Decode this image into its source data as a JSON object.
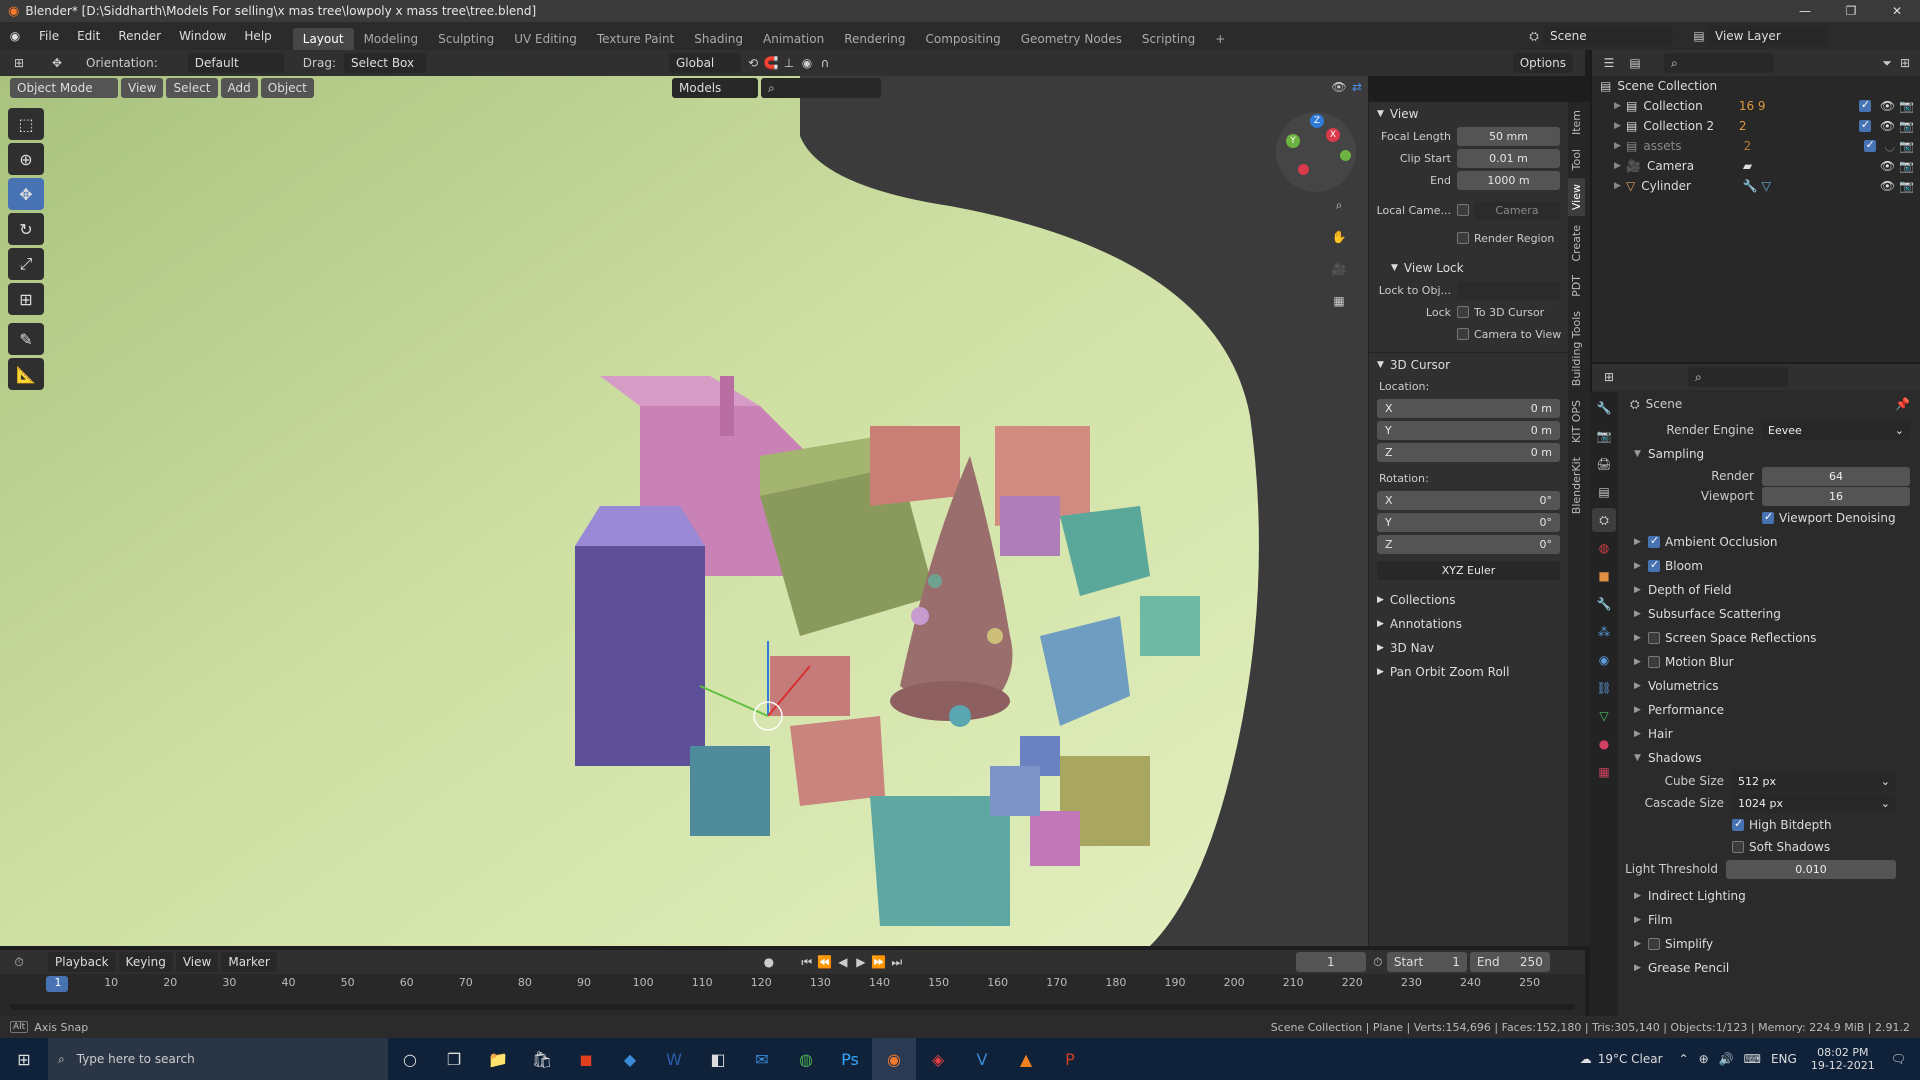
{
  "window": {
    "title": "Blender* [D:\\Siddharth\\Models For selling\\x mas tree\\lowpoly x mass tree\\tree.blend]",
    "controls": [
      "—",
      "❐",
      "✕"
    ]
  },
  "menu": [
    "File",
    "Edit",
    "Render",
    "Window",
    "Help"
  ],
  "workspaces": [
    "Layout",
    "Modeling",
    "Sculpting",
    "UV Editing",
    "Texture Paint",
    "Shading",
    "Animation",
    "Rendering",
    "Compositing",
    "Geometry Nodes",
    "Scripting"
  ],
  "active_workspace": "Layout",
  "scene_selector": "Scene",
  "view_layer": "View Layer",
  "header": {
    "orientation_label": "Orientation:",
    "orientation_value": "Default",
    "drag_label": "Drag:",
    "drag_value": "Select Box",
    "transform": "Global",
    "options": "Options"
  },
  "viewport_header": {
    "mode": "Object Mode",
    "menus": [
      "View",
      "Select",
      "Add",
      "Object"
    ],
    "models": "Models"
  },
  "npanel": {
    "view_title": "View",
    "focal_length_label": "Focal Length",
    "focal_length": "50 mm",
    "clip_start_label": "Clip Start",
    "clip_start": "0.01 m",
    "end_label": "End",
    "end": "1000 m",
    "local_camera_label": "Local Came...",
    "local_camera_value": "Camera",
    "render_region": "Render Region",
    "view_lock_title": "View Lock",
    "lock_to_obj_label": "Lock to Obj...",
    "lock_label": "Lock",
    "to_3d_cursor": "To 3D Cursor",
    "camera_to_view": "Camera to View",
    "cursor_title": "3D Cursor",
    "location_label": "Location:",
    "rotation_label": "Rotation:",
    "location": [
      {
        "axis": "X",
        "value": "0 m"
      },
      {
        "axis": "Y",
        "value": "0 m"
      },
      {
        "axis": "Z",
        "value": "0 m"
      }
    ],
    "rotation": [
      {
        "axis": "X",
        "value": "0°"
      },
      {
        "axis": "Y",
        "value": "0°"
      },
      {
        "axis": "Z",
        "value": "0°"
      }
    ],
    "rotation_mode": "XYZ Euler",
    "collapsed": [
      "Collections",
      "Annotations",
      "3D Nav",
      "Pan Orbit Zoom Roll"
    ]
  },
  "side_tabs": [
    "Item",
    "Tool",
    "View",
    "Create",
    "PDT",
    "Building Tools",
    "KIT OPS",
    "BlenderKit"
  ],
  "active_side_tab": "View",
  "outliner": {
    "root": "Scene Collection",
    "items": [
      {
        "name": "Collection",
        "dim": false,
        "badges": "16 9"
      },
      {
        "name": "Collection 2",
        "dim": false,
        "badges": "2"
      },
      {
        "name": "assets",
        "dim": true,
        "badges": "2"
      },
      {
        "name": "Camera",
        "dim": false,
        "badges": ""
      },
      {
        "name": "Cylinder",
        "dim": false,
        "badges": ""
      }
    ]
  },
  "properties": {
    "context": "Scene",
    "render_engine_label": "Render Engine",
    "render_engine": "Eevee",
    "sampling": "Sampling",
    "render_label": "Render",
    "render_samples": "64",
    "viewport_label": "Viewport",
    "viewport_samples": "16",
    "viewport_denoising": "Viewport Denoising",
    "sections": [
      {
        "label": "Ambient Occlusion",
        "check": true,
        "checked": true
      },
      {
        "label": "Bloom",
        "check": true,
        "checked": true
      },
      {
        "label": "Depth of Field",
        "check": false,
        "checked": false
      },
      {
        "label": "Subsurface Scattering",
        "check": false,
        "checked": false
      },
      {
        "label": "Screen Space Reflections",
        "check": true,
        "checked": false
      },
      {
        "label": "Motion Blur",
        "check": true,
        "checked": false
      },
      {
        "label": "Volumetrics",
        "check": false,
        "checked": false
      },
      {
        "label": "Performance",
        "check": false,
        "checked": false
      },
      {
        "label": "Hair",
        "check": false,
        "checked": false
      }
    ],
    "shadows": "Shadows",
    "cube_size_label": "Cube Size",
    "cube_size": "512 px",
    "cascade_size_label": "Cascade Size",
    "cascade_size": "1024 px",
    "high_bitdepth": "High Bitdepth",
    "soft_shadows": "Soft Shadows",
    "light_threshold_label": "Light Threshold",
    "light_threshold": "0.010",
    "after_sections": [
      {
        "label": "Indirect Lighting",
        "check": false
      },
      {
        "label": "Film",
        "check": false
      },
      {
        "label": "Simplify",
        "check": true
      },
      {
        "label": "Grease Pencil",
        "check": false
      }
    ]
  },
  "timeline": {
    "menus": [
      "Playback",
      "Keying",
      "View",
      "Marker"
    ],
    "current_frame": "1",
    "start_label": "Start",
    "start": "1",
    "end_label": "End",
    "end": "250",
    "ticks": [
      "1",
      "10",
      "20",
      "30",
      "40",
      "50",
      "60",
      "70",
      "80",
      "90",
      "100",
      "110",
      "120",
      "130",
      "140",
      "150",
      "160",
      "170",
      "180",
      "190",
      "200",
      "210",
      "220",
      "230",
      "240",
      "250"
    ]
  },
  "status": {
    "left": "Axis Snap",
    "right": "Scene Collection | Plane | Verts:154,696 | Faces:152,180 | Tris:305,140 | Objects:1/123 | Memory: 224.9 MiB | 2.91.2"
  },
  "taskbar": {
    "search_placeholder": "Type here to search",
    "weather": "19°C  Clear",
    "lang": "ENG",
    "time": "08:02 PM",
    "date": "19-12-2021"
  }
}
